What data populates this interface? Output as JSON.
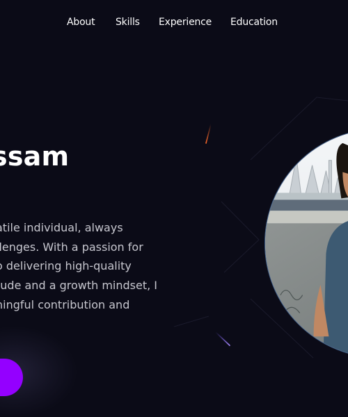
{
  "nav": {
    "items": [
      {
        "label": "About"
      },
      {
        "label": "Skills"
      },
      {
        "label": "Experience"
      },
      {
        "label": "Education"
      }
    ]
  },
  "hero": {
    "title_visible": "ssam",
    "bio_lines": [
      "atile individual, always",
      "llenges. With a passion for",
      "o delivering high-quality",
      "tude and a growth mindset, I",
      "ningful contribution and"
    ]
  },
  "colors": {
    "background": "#0b0b17",
    "accent": "#9400ff",
    "photo_border": "#3e5f8c",
    "nav_text": "#ffffff",
    "body_text": "#c7c7cf"
  }
}
